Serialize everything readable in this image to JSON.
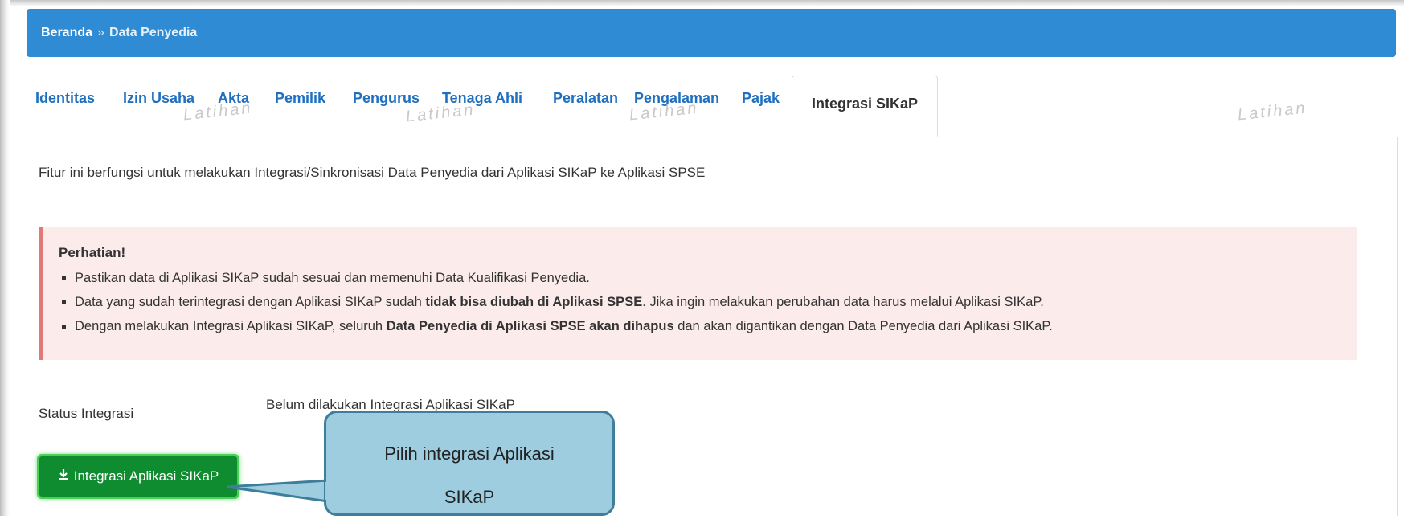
{
  "breadcrumb": {
    "home": "Beranda",
    "separator": "»",
    "current": "Data Penyedia"
  },
  "tabs": [
    {
      "label": "Identitas"
    },
    {
      "label": "Izin Usaha"
    },
    {
      "label": "Akta"
    },
    {
      "label": "Pemilik"
    },
    {
      "label": "Pengurus"
    },
    {
      "label": "Tenaga Ahli"
    },
    {
      "label": "Peralatan"
    },
    {
      "label": "Pengalaman"
    },
    {
      "label": "Pajak"
    },
    {
      "label": "Integrasi SIKaP"
    }
  ],
  "watermark": "Latihan",
  "intro": "Fitur ini berfungsi untuk melakukan Integrasi/Sinkronisasi Data Penyedia dari Aplikasi SIKaP ke Aplikasi SPSE",
  "alert": {
    "title": "Perhatian!",
    "item1": "Pastikan data di Aplikasi SIKaP sudah sesuai dan memenuhi Data Kualifikasi Penyedia.",
    "item2_pre": "Data yang sudah terintegrasi dengan Aplikasi SIKaP sudah ",
    "item2_bold": "tidak bisa diubah di Aplikasi SPSE",
    "item2_post": ". Jika ingin melakukan perubahan data harus melalui Aplikasi SIKaP.",
    "item3_pre": "Dengan melakukan Integrasi Aplikasi SIKaP, seluruh ",
    "item3_bold": "Data Penyedia di Aplikasi SPSE akan dihapus",
    "item3_post": " dan akan digantikan dengan Data Penyedia dari Aplikasi SIKaP."
  },
  "status": {
    "label": "Status Integrasi",
    "value": "Belum dilakukan Integrasi Aplikasi SIKaP"
  },
  "button": {
    "label": "Integrasi Aplikasi SIKaP",
    "icon": "download-icon"
  },
  "callout": {
    "line1": "Pilih integrasi Aplikasi",
    "line2": "SIKaP"
  }
}
